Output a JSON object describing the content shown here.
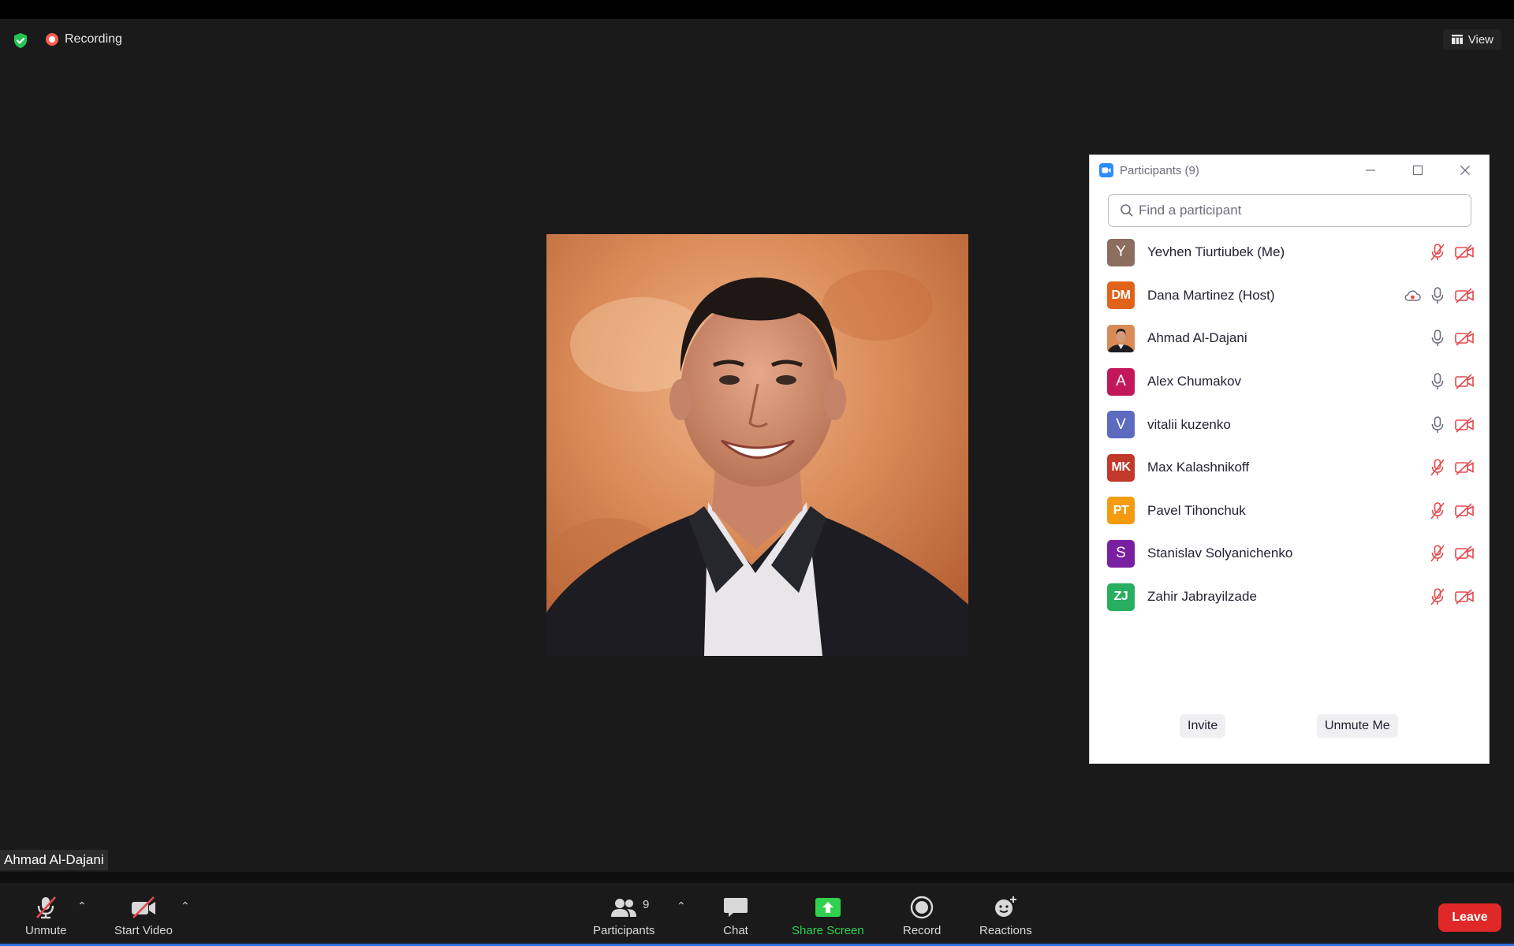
{
  "top": {
    "recording_label": "Recording",
    "view_label": "View"
  },
  "speaker": {
    "name": "Ahmad Al-Dajani"
  },
  "toolbar": {
    "unmute_label": "Unmute",
    "start_video_label": "Start Video",
    "participants_label": "Participants",
    "participants_count": "9",
    "chat_label": "Chat",
    "share_screen_label": "Share Screen",
    "record_label": "Record",
    "reactions_label": "Reactions",
    "leave_label": "Leave"
  },
  "panel": {
    "title": "Participants (9)",
    "search_placeholder": "Find a participant",
    "invite_label": "Invite",
    "unmute_me_label": "Unmute Me",
    "participants": [
      {
        "initials": "Y",
        "name": "Yevhen Tiurtiubek (Me)",
        "color": "#8c6e5e",
        "mic": "muted",
        "video": "off",
        "recording": false
      },
      {
        "initials": "DM",
        "name": "Dana Martinez (Host)",
        "color": "#e0631b",
        "mic": "on",
        "video": "off",
        "recording": true
      },
      {
        "initials": "",
        "name": "Ahmad Al-Dajani",
        "color": "#b5703d",
        "mic": "on",
        "video": "off",
        "recording": false
      },
      {
        "initials": "A",
        "name": "Alex Chumakov",
        "color": "#c2185b",
        "mic": "on",
        "video": "off",
        "recording": false
      },
      {
        "initials": "V",
        "name": "vitalii kuzenko",
        "color": "#5c6bc0",
        "mic": "on",
        "video": "off",
        "recording": false
      },
      {
        "initials": "MK",
        "name": "Max Kalashnikoff",
        "color": "#c0392b",
        "mic": "muted",
        "video": "off",
        "recording": false
      },
      {
        "initials": "PT",
        "name": "Pavel Tihonchuk",
        "color": "#f39c12",
        "mic": "muted",
        "video": "off",
        "recording": false
      },
      {
        "initials": "S",
        "name": "Stanislav Solyanichenko",
        "color": "#7b1fa2",
        "mic": "muted",
        "video": "off",
        "recording": false
      },
      {
        "initials": "ZJ",
        "name": "Zahir Jabrayilzade",
        "color": "#27ae60",
        "mic": "muted",
        "video": "off",
        "recording": false
      }
    ]
  },
  "colors": {
    "accent_green": "#2fd14e",
    "leave_red": "#e02828",
    "muted_red": "#e5484d",
    "zoom_blue": "#2d8cff"
  }
}
